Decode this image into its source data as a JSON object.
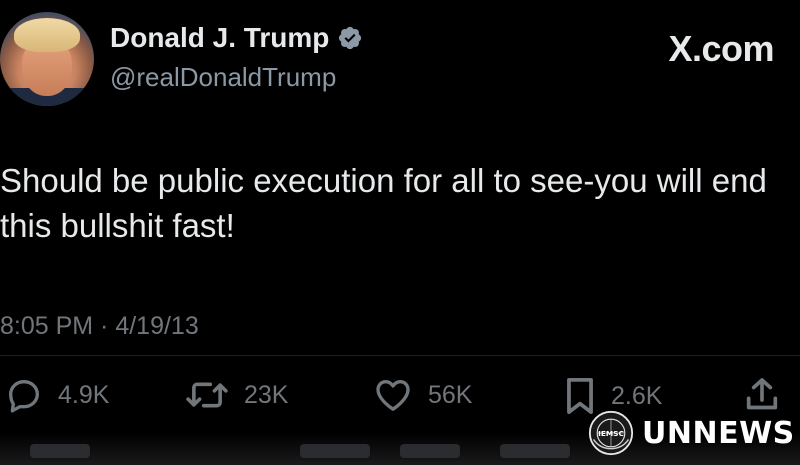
{
  "header": {
    "display_name": "Donald J. Trump",
    "handle": "@realDonaldTrump",
    "brand": "X.com",
    "verified_color": "#8b98a5"
  },
  "tweet": {
    "text": "Should be public execution for all to see-you will end this bullshit fast!",
    "timestamp": "8:05 PM · 4/19/13"
  },
  "actions": {
    "replies": "4.9K",
    "reposts": "23K",
    "likes": "56K",
    "bookmarks": "2.6K"
  },
  "icons": {
    "reply": "reply-icon",
    "repost": "repost-icon",
    "like": "heart-icon",
    "bookmark": "bookmark-icon",
    "share": "share-icon",
    "verified": "verified-badge-icon"
  },
  "watermark": {
    "text": "UNNEWS",
    "seal_text": "IEMSC"
  },
  "colors": {
    "background": "#000000",
    "primary_text": "#e7e9ea",
    "secondary_text": "#71767b"
  }
}
